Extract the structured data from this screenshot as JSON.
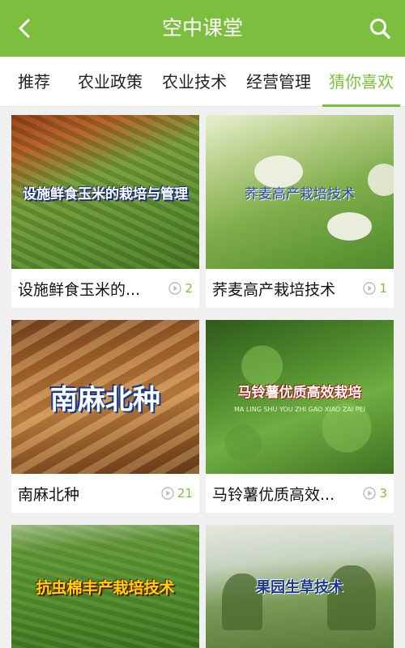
{
  "header": {
    "title": "空中课堂",
    "back_icon": "chevron-left-icon",
    "search_icon": "search-icon",
    "color": "#7cbf3f"
  },
  "tabs": [
    {
      "label": "推荐",
      "active": false
    },
    {
      "label": "农业政策",
      "active": false
    },
    {
      "label": "农业技术",
      "active": false
    },
    {
      "label": "经营管理",
      "active": false
    },
    {
      "label": "猜你喜欢",
      "active": true
    }
  ],
  "cards": [
    {
      "name": "设施鲜食玉米的...",
      "overlay": "设施鲜食玉米的栽培与管理",
      "plays": "2"
    },
    {
      "name": "荞麦高产栽培技术",
      "overlay": "荞麦高产栽培技术",
      "plays": "1"
    },
    {
      "name": "南麻北种",
      "overlay": "南麻北种",
      "plays": "21"
    },
    {
      "name": "马铃薯优质高效...",
      "overlay": "马铃薯优质高效栽培",
      "overlay_sub": "MA LING SHU YOU ZHI GAO XIAO ZAI PEI",
      "plays": "3"
    },
    {
      "name": "",
      "overlay": "抗虫棉丰产栽培技术",
      "plays": ""
    },
    {
      "name": "",
      "overlay": "果园生草技术",
      "plays": ""
    }
  ]
}
